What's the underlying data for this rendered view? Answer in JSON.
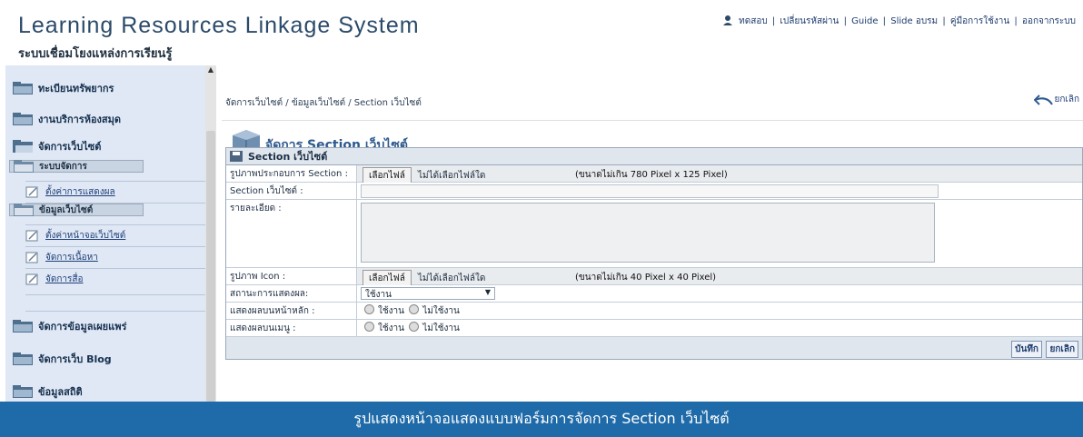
{
  "header": {
    "title": "Learning Resources Linkage System",
    "subtitle": "ระบบเชื่อมโยงแหล่งการเรียนรู้",
    "nav": {
      "user": "ทดสอบ",
      "change_password": "เปลี่ยนรหัสผ่าน",
      "guide": "Guide",
      "slide": "Slide อบรม",
      "manual": "คู่มือการใช้งาน",
      "logout": "ออกจากระบบ"
    }
  },
  "sidebar": {
    "items": [
      {
        "label": "ทะเบียนทรัพยากร"
      },
      {
        "label": "งานบริการห้องสมุด"
      },
      {
        "label": "จัดการเว็บไซต์"
      },
      {
        "label": "จัดการข้อมูลเผยแพร่"
      },
      {
        "label": "จัดการเว็บ Blog"
      },
      {
        "label": "ข้อมูลสถิติ"
      }
    ],
    "subitems": [
      {
        "label": "ระบบจัดการ"
      },
      {
        "label": "ตั้งค่าการแสดงผล"
      },
      {
        "label": "ข้อมูลเว็บไซต์"
      },
      {
        "label": "ตั้งค่าหน้าจอเว็บไซต์"
      },
      {
        "label": "จัดการเนื้อหา"
      },
      {
        "label": "จัดการสื่อ"
      }
    ]
  },
  "main": {
    "breadcrumb": "จัดการเว็บไซต์ / ข้อมูลเว็บไซต์ / Section เว็บไซต์",
    "undo_label": "ยกเลิก",
    "page_title": "จัดการ Section เว็บไซต์",
    "form": {
      "header": "Section เว็บไซต์",
      "image_label": "รูปภาพประกอบการ Section :",
      "choose_file": "เลือกไฟล์",
      "no_file": "ไม่ได้เลือกไฟล์ใด",
      "image_hint": "(ขนาดไม่เกิน 780 Pixel x 125 Pixel)",
      "section_label": "Section เว็บไซต์ :",
      "detail_label": "รายละเอียด :",
      "icon_label": "รูปภาพ Icon :",
      "icon_hint": "(ขนาดไม่เกิน 40 Pixel x 40 Pixel)",
      "status_label": "สถานะการแสดงผล:",
      "status_value": "ใช้งาน",
      "home_label": "แสดงผลบนหน้าหลัก :",
      "menu_label": "แสดงผลบนเมนู :",
      "opt_on": "ใช้งาน",
      "opt_off": "ไม่ใช้งาน",
      "save": "บันทึก",
      "cancel": "ยกเลิก"
    }
  },
  "caption": "รูปแสดงหน้าจอแสดงแบบฟอร์มการจัดการ Section เว็บไซต์"
}
